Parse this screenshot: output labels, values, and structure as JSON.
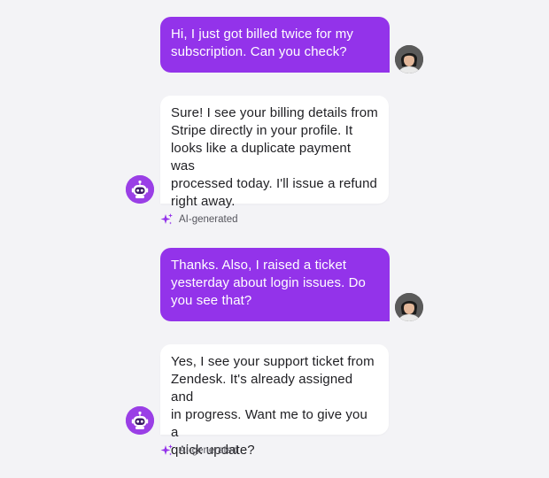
{
  "messages": [
    {
      "role": "user",
      "text": "Hi, I just got billed twice for my\nsubscription. Can you check?"
    },
    {
      "role": "assistant",
      "text": "Sure! I see your billing details from\nStripe directly in your profile. It\nlooks like a duplicate payment was\nprocessed today. I'll issue a refund\nright away.",
      "tag": "AI-generated"
    },
    {
      "role": "user",
      "text": "Thanks. Also, I raised a ticket\nyesterday about login issues. Do\nyou see that?"
    },
    {
      "role": "assistant",
      "text": "Yes, I see your support ticket from\nZendesk. It's already assigned and\nin progress. Want me to give you a\nquick update?",
      "tag": "AI-generated"
    }
  ],
  "colors": {
    "user_bubble": "#9333ea",
    "bot_avatar": "#9a3fe6",
    "sparkle": "#9333ea",
    "background": "#f3f3f6"
  },
  "icons": {
    "user_avatar": "person-photo-avatar",
    "bot_avatar": "robot-icon",
    "ai_tag": "sparkle-icon"
  }
}
